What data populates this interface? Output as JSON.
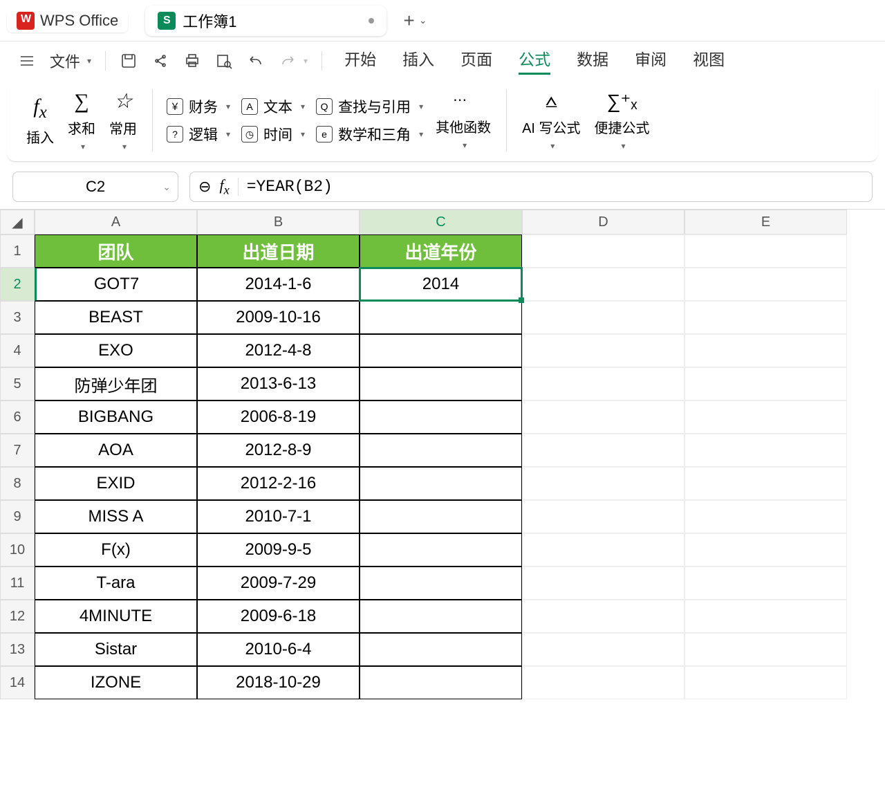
{
  "app": {
    "name": "WPS Office"
  },
  "workbook": {
    "tab_name": "工作簿1"
  },
  "menubar": {
    "file": "文件"
  },
  "main_tabs": [
    "开始",
    "插入",
    "页面",
    "公式",
    "数据",
    "审阅",
    "视图"
  ],
  "main_tabs_active_index": 3,
  "ribbon": {
    "insert": "插入",
    "sum": "求和",
    "favorite": "常用",
    "finance": "财务",
    "text_fn": "文本",
    "lookup": "查找与引用",
    "logic": "逻辑",
    "time": "时间",
    "math": "数学和三角",
    "other": "其他函数",
    "ai": "AI 写公式",
    "quick": "便捷公式"
  },
  "namebox": "C2",
  "formula": "=YEAR(B2)",
  "columns": [
    "A",
    "B",
    "C",
    "D",
    "E"
  ],
  "headers": {
    "A": "团队",
    "B": "出道日期",
    "C": "出道年份"
  },
  "rows": [
    {
      "n": 1
    },
    {
      "n": 2,
      "A": "GOT7",
      "B": "2014-1-6",
      "C": "2014"
    },
    {
      "n": 3,
      "A": "BEAST",
      "B": "2009-10-16",
      "C": ""
    },
    {
      "n": 4,
      "A": "EXO",
      "B": "2012-4-8",
      "C": ""
    },
    {
      "n": 5,
      "A": "防弹少年团",
      "B": "2013-6-13",
      "C": ""
    },
    {
      "n": 6,
      "A": "BIGBANG",
      "B": "2006-8-19",
      "C": ""
    },
    {
      "n": 7,
      "A": "AOA",
      "B": "2012-8-9",
      "C": ""
    },
    {
      "n": 8,
      "A": "EXID",
      "B": "2012-2-16",
      "C": ""
    },
    {
      "n": 9,
      "A": "MISS A",
      "B": "2010-7-1",
      "C": ""
    },
    {
      "n": 10,
      "A": "F(x)",
      "B": "2009-9-5",
      "C": ""
    },
    {
      "n": 11,
      "A": "T-ara",
      "B": "2009-7-29",
      "C": ""
    },
    {
      "n": 12,
      "A": "4MINUTE",
      "B": "2009-6-18",
      "C": ""
    },
    {
      "n": 13,
      "A": "Sistar",
      "B": "2010-6-4",
      "C": ""
    },
    {
      "n": 14,
      "A": "IZONE",
      "B": "2018-10-29",
      "C": ""
    }
  ],
  "selected": {
    "row": 2,
    "col": "C"
  }
}
